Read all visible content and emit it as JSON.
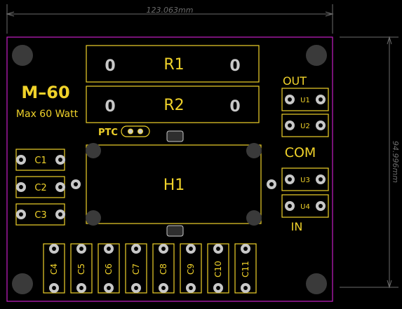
{
  "board": {
    "title": "M–60",
    "subtitle": "Max 60 Watt",
    "width_dim": "123.063mm",
    "height_dim": "94.996mm"
  },
  "colors": {
    "background": "#000000",
    "outline": "#c61fc6",
    "silkscreen": "#f0d22a",
    "pad": "#c8c8c8",
    "dimension": "#6b6b6b",
    "mount_hole": "#3a3a3a"
  },
  "resistors": [
    {
      "ref": "R1",
      "pad_label": "0"
    },
    {
      "ref": "R2",
      "pad_label": "0"
    }
  ],
  "ptc": {
    "label": "PTC"
  },
  "heater": {
    "ref": "H1"
  },
  "caps_left": [
    "C1",
    "C2",
    "C3"
  ],
  "caps_bottom": [
    "C4",
    "C5",
    "C6",
    "C7",
    "C8",
    "C9",
    "C10",
    "C11"
  ],
  "connectors": {
    "out_label": "OUT",
    "com_label": "COM",
    "in_label": "IN",
    "units": [
      "U1",
      "U2",
      "U3",
      "U4"
    ]
  }
}
